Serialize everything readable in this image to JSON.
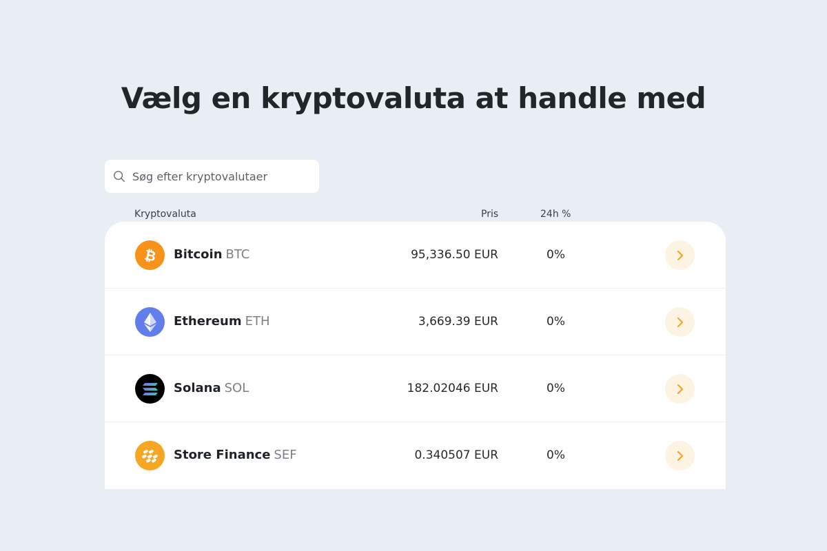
{
  "header": {
    "title": "Vælg en kryptovaluta at handle med"
  },
  "search": {
    "placeholder": "Søg efter kryptovalutaer"
  },
  "columns": {
    "name": "Kryptovaluta",
    "price": "Pris",
    "change": "24h %"
  },
  "coins": [
    {
      "name": "Bitcoin",
      "symbol": "BTC",
      "price": "95,336.50 EUR",
      "change": "0%",
      "icon": "bitcoin-icon",
      "color": "#f7931a"
    },
    {
      "name": "Ethereum",
      "symbol": "ETH",
      "price": "3,669.39 EUR",
      "change": "0%",
      "icon": "ethereum-icon",
      "color": "#627eea"
    },
    {
      "name": "Solana",
      "symbol": "SOL",
      "price": "182.02046 EUR",
      "change": "0%",
      "icon": "solana-icon",
      "color": "#000000"
    },
    {
      "name": "Store Finance",
      "symbol": "SEF",
      "price": "0.340507 EUR",
      "change": "0%",
      "icon": "store-finance-icon",
      "color": "#f5a623"
    }
  ],
  "accent": "#f5a623"
}
